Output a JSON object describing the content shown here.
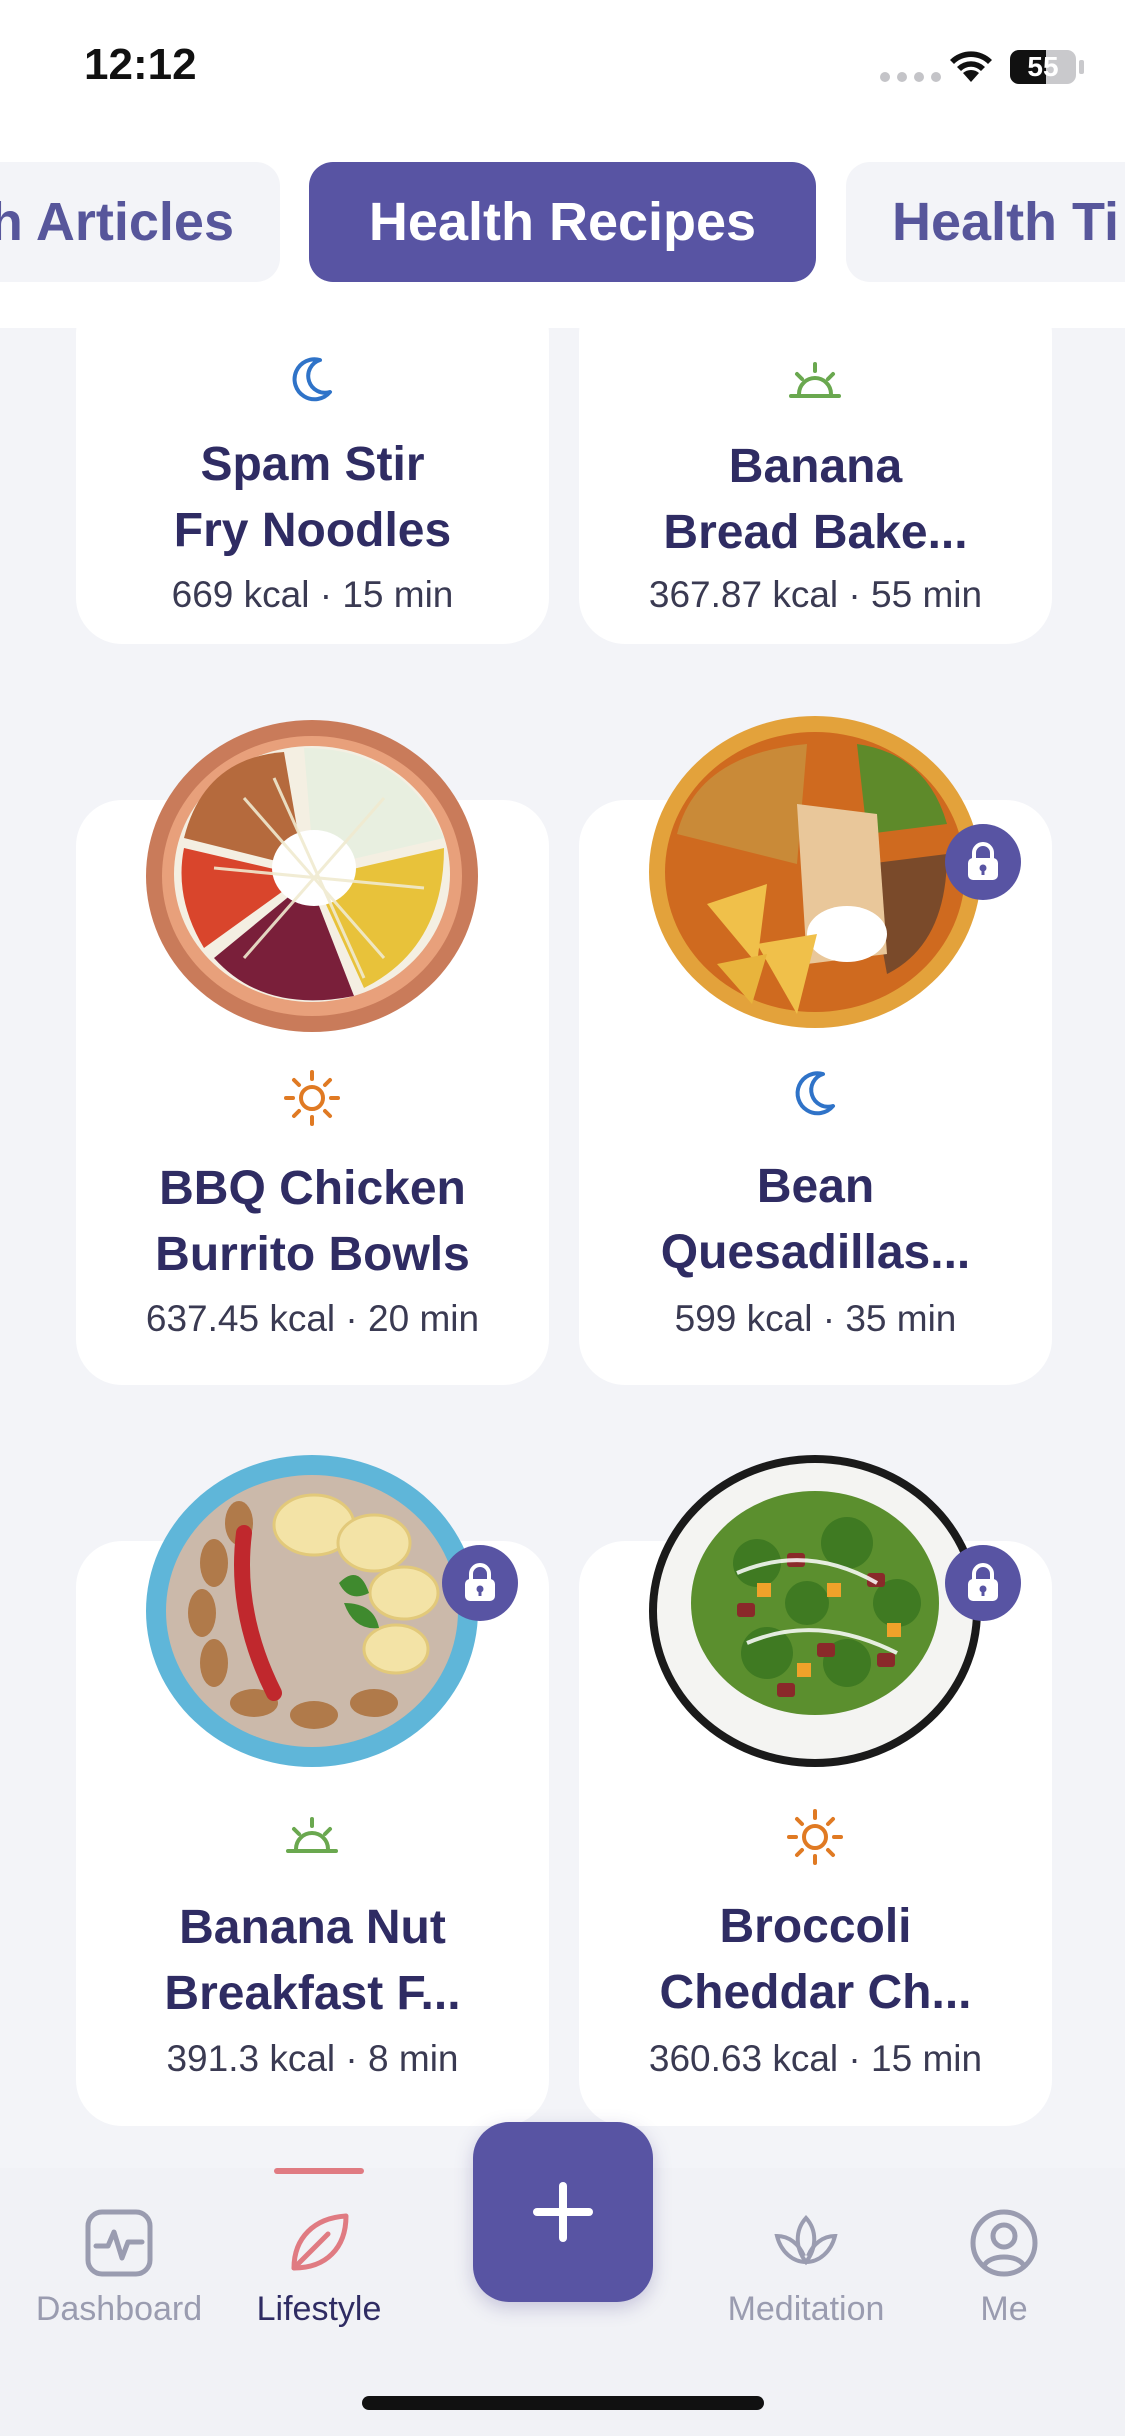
{
  "status_bar": {
    "time": "12:12",
    "battery": "55"
  },
  "tabs": [
    {
      "label": "Health Articles",
      "visible_text": "h Articles",
      "active": false
    },
    {
      "label": "Health Recipes",
      "visible_text": "Health Recipes",
      "active": true
    },
    {
      "label": "Health Tips",
      "visible_text": "Health Ti",
      "active": false
    }
  ],
  "recipes": [
    {
      "title_line1": "Spam Stir",
      "title_line2": "Fry Noodles",
      "meta": "669 kcal · 15 min",
      "meal_icon": "moon-icon",
      "locked": false
    },
    {
      "title_line1": "Banana",
      "title_line2": "Bread Bake...",
      "meta": "367.87 kcal · 55 min",
      "meal_icon": "sunrise-icon",
      "locked": false
    },
    {
      "title_line1": "BBQ Chicken",
      "title_line2": "Burrito Bowls",
      "meta": "637.45 kcal · 20 min",
      "meal_icon": "sun-icon",
      "locked": false,
      "image": "burrito-bowl-image"
    },
    {
      "title_line1": "Bean",
      "title_line2": "Quesadillas...",
      "meta": "599 kcal · 35 min",
      "meal_icon": "moon-icon",
      "locked": true,
      "image": "quesadilla-plate-image"
    },
    {
      "title_line1": "Banana Nut",
      "title_line2": "Breakfast F...",
      "meta": "391.3 kcal · 8 min",
      "meal_icon": "sunrise-icon",
      "locked": true,
      "image": "oatmeal-bowl-image"
    },
    {
      "title_line1": "Broccoli",
      "title_line2": "Cheddar Ch...",
      "meta": "360.63 kcal · 15 min",
      "meal_icon": "sun-icon",
      "locked": true,
      "image": "broccoli-salad-image"
    }
  ],
  "bottom_nav": [
    {
      "label": "Dashboard",
      "icon": "heartbeat-icon",
      "active": false
    },
    {
      "label": "Lifestyle",
      "icon": "leaf-icon",
      "active": true
    },
    {
      "label": "Meditation",
      "icon": "lotus-icon",
      "active": false
    },
    {
      "label": "Me",
      "icon": "user-icon",
      "active": false
    }
  ],
  "fab": {
    "icon": "plus-icon"
  },
  "colors": {
    "primary": "#5854a3",
    "title_text": "#2f2c63",
    "moon": "#2f73c8",
    "sunrise": "#6aa84f",
    "sun": "#e07a23",
    "nav_indicator": "#e07b82"
  }
}
